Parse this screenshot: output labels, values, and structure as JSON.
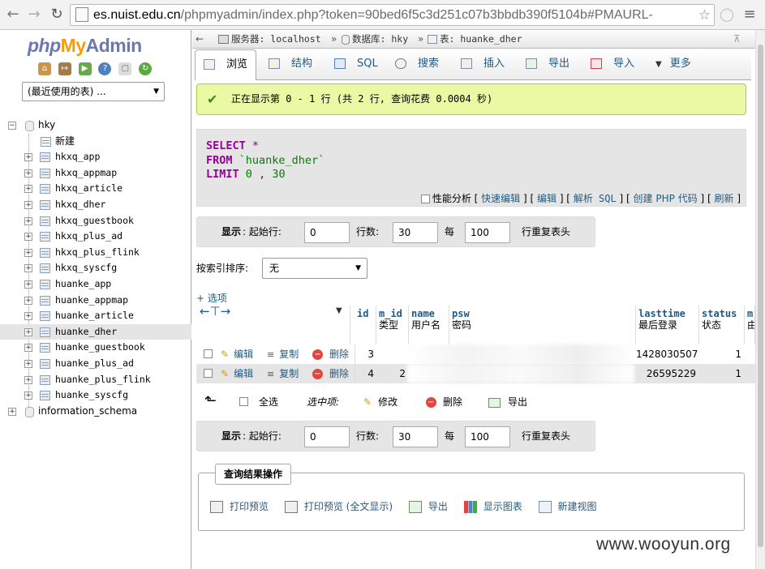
{
  "browser": {
    "url_host": "es.nuist.edu.cn",
    "url_path": "/phpmyadmin/index.php?token=90bed6f5c3d251c07b3bbdb390f5104b#PMAURL-"
  },
  "sidebar": {
    "logo_php": "php",
    "logo_my": "My",
    "logo_admin": "Admin",
    "recent_select": "(最近使用的表) ...",
    "db_name": "hky",
    "new_label": "新建",
    "tables": [
      "hkxq_app",
      "hkxq_appmap",
      "hkxq_article",
      "hkxq_dher",
      "hkxq_guestbook",
      "hkxq_plus_ad",
      "hkxq_plus_flink",
      "hkxq_syscfg",
      "huanke_app",
      "huanke_appmap",
      "huanke_article",
      "huanke_dher",
      "huanke_guestbook",
      "huanke_plus_ad",
      "huanke_plus_flink",
      "huanke_syscfg"
    ],
    "selected_table": "huanke_dher",
    "other_db": "information_schema"
  },
  "breadcrumb": {
    "server_label": "服务器: localhost",
    "db_label": "数据库: hky",
    "table_label": "表: huanke_dher",
    "sep": "»"
  },
  "tabs": [
    "浏览",
    "结构",
    "SQL",
    "搜索",
    "插入",
    "导出",
    "导入",
    "更多"
  ],
  "message": "正在显示第 0 - 1 行 (共 2 行, 查询花费 0.0004 秒)",
  "sql": {
    "kw_select": "SELECT",
    "star": "*",
    "kw_from": "FROM",
    "table": "`huanke_dher`",
    "kw_limit": "LIMIT",
    "limit_start": "0",
    "limit_sep": ",",
    "limit_count": "30"
  },
  "sql_actions": {
    "profiling": "性能分析",
    "inline_edit": "快速编辑",
    "edit": "编辑",
    "explain": "解析 SQL",
    "create_php": "创建 PHP 代码",
    "refresh": "刷新"
  },
  "nav": {
    "show_label": "显示",
    "start_label": ": 起始行:",
    "start_value": "0",
    "rows_label": "行数:",
    "rows_value": "30",
    "every_label": "每",
    "every_value": "100",
    "repeat_label": "行重复表头"
  },
  "sort": {
    "label": "按索引排序:",
    "value": "无"
  },
  "options_link": "+ 选项",
  "columns": [
    {
      "name": "id",
      "type": ""
    },
    {
      "name": "m_id",
      "type": "类型"
    },
    {
      "name": "name",
      "type": "用户名"
    },
    {
      "name": "psw",
      "type": "密码"
    },
    {
      "name": "lasttime",
      "type": "最后登录"
    },
    {
      "name": "status",
      "type": "状态"
    },
    {
      "name": "m",
      "type": "由"
    }
  ],
  "row_actions": {
    "edit": "编辑",
    "copy": "复制",
    "delete": "删除"
  },
  "rows": [
    {
      "id": "3",
      "m_id": "",
      "lasttime": "1428030507",
      "status": "1"
    },
    {
      "id": "4",
      "m_id": "2",
      "lasttime": "26595229",
      "status": "1"
    }
  ],
  "bulk": {
    "check_all": "全选",
    "with_selected": "选中项:",
    "edit": "修改",
    "delete": "删除",
    "export": "导出"
  },
  "result_ops": {
    "legend": "查询结果操作",
    "print": "打印预览",
    "print_full": "打印预览 (全文显示)",
    "export": "导出",
    "chart": "显示图表",
    "view": "新建视图"
  },
  "watermark": "www.wooyun.org"
}
